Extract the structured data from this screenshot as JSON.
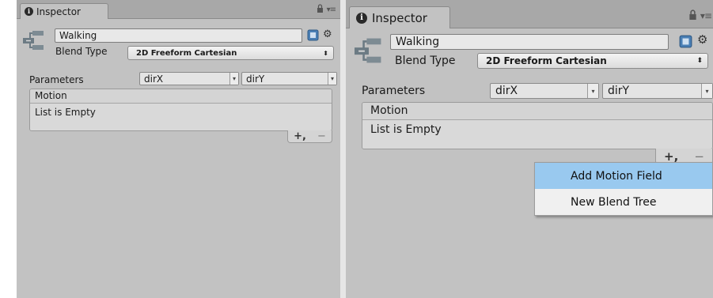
{
  "inspector": {
    "tab_label": "Inspector",
    "info_glyph": "i",
    "lock_glyph": "🔒",
    "menu_glyph": "▾≡",
    "object_name": "Walking",
    "blend_type_label": "Blend Type",
    "blend_type_value": "2D Freeform Cartesian",
    "parameters_label": "Parameters",
    "param_x": "dirX",
    "param_y": "dirY",
    "motion_header": "Motion",
    "list_empty": "List is Empty",
    "add_glyph": "+,",
    "remove_glyph": "−"
  },
  "context_menu": {
    "items": [
      "Add Motion Field",
      "New Blend Tree"
    ]
  },
  "colors": {
    "panel_bg": "#c2c2c2",
    "menu_highlight": "#99c9ef"
  }
}
